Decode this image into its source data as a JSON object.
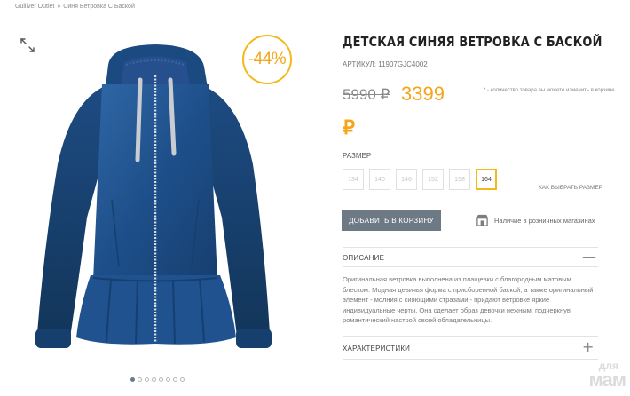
{
  "breadcrumb": {
    "items": [
      "Gulliver Outlet",
      "Синя Ветровка С Баской"
    ],
    "separator": "»"
  },
  "gallery": {
    "expand_icon": "expand-arrows-icon",
    "discount": "-44%",
    "slide_count": 8,
    "active_slide": 0
  },
  "product": {
    "title": "ДЕТСКАЯ СИНЯЯ ВЕТРОВКА С БАСКОЙ",
    "article": "АРТИКУЛ: 11907GJC4002",
    "old_price": "5990 ₽",
    "new_price": "3399",
    "currency": "₽",
    "qty_note": "* - количество товара вы можете изменить в корзине"
  },
  "sizes": {
    "label": "РАЗМЕР",
    "options": [
      "134",
      "140",
      "146",
      "152",
      "158",
      "164"
    ],
    "selected": "164",
    "guide": "КАК ВЫБРАТЬ РАЗМЕР"
  },
  "actions": {
    "add_to_cart": "ДОБАВИТЬ В КОРЗИНУ",
    "store_icon": "store-icon",
    "store_availability": "Наличие в розничных магазинах"
  },
  "description": {
    "title": "ОПИСАНИЕ",
    "toggle": "—",
    "text": "Оригинальная ветровка выполнена из плащевки с благородным матовым блеском. Модная девичья форма с присборенной баской, а также оригинальный элемент - молния с сияющими стразами - придают ветровке яркие индивидуальные черты. Она сделает образ девочки нежным, подчеркнув романтический настрой своей обладательницы."
  },
  "characteristics": {
    "title": "ХАРАКТЕРИСТИКИ",
    "toggle": "+"
  },
  "watermark": {
    "line1": "для",
    "line2": "мам"
  },
  "colors": {
    "accent": "#f4b81a",
    "price": "#f4a51a",
    "button": "#6d7a86",
    "jacket": "#1e4f8a"
  }
}
